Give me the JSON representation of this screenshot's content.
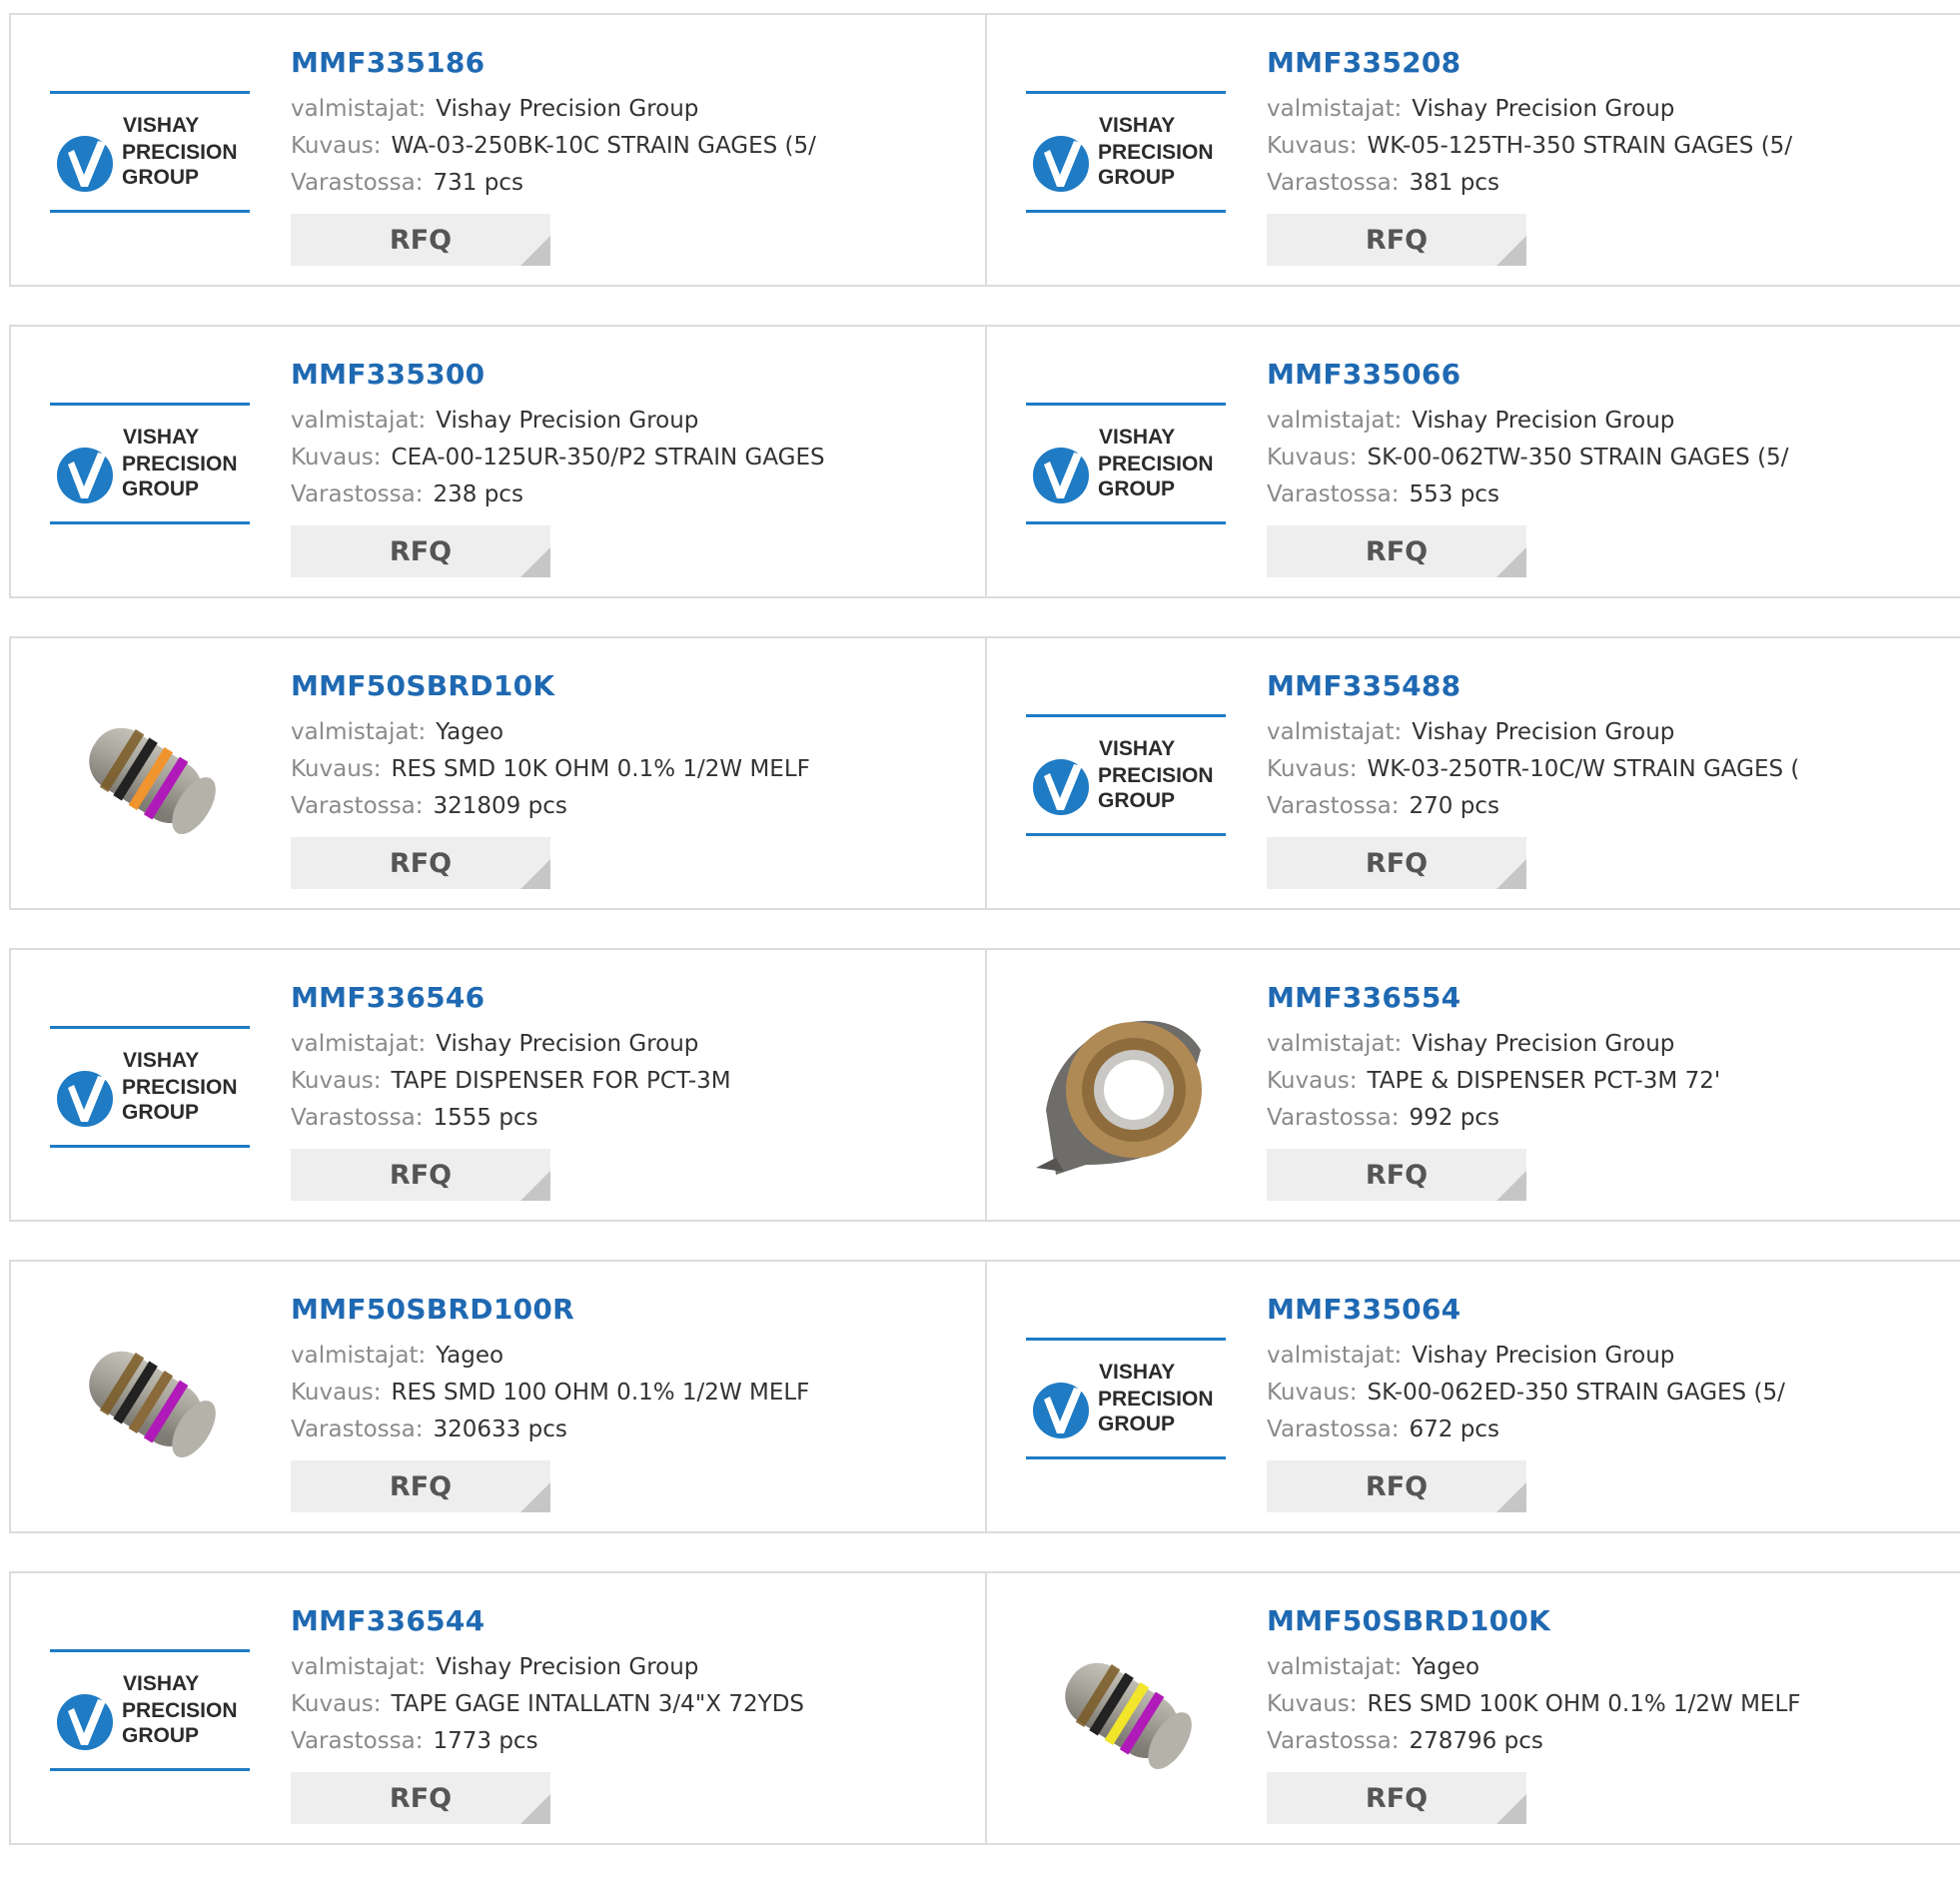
{
  "labels": {
    "manufacturer": "valmistajat:",
    "description": "Kuvaus:",
    "stock": "Varastossa:",
    "rfq": "RFQ"
  },
  "logo_text": [
    "VISHAY",
    "PRECISION",
    "GROUP"
  ],
  "colors": {
    "link": "#1f69b2",
    "vishay_blue": "#1e7bc4",
    "button_bg": "#eeeeee"
  },
  "products": [
    {
      "pn": "MMF335186",
      "manufacturer": "Vishay Precision Group",
      "description": "WA-03-250BK-10C STRAIN GAGES (5/",
      "stock": "731 pcs",
      "image": "vishay-logo"
    },
    {
      "pn": "MMF335208",
      "manufacturer": "Vishay Precision Group",
      "description": "WK-05-125TH-350 STRAIN GAGES (5/",
      "stock": "381 pcs",
      "image": "vishay-logo"
    },
    {
      "pn": "MMF335300",
      "manufacturer": "Vishay Precision Group",
      "description": "CEA-00-125UR-350/P2 STRAIN GAGES",
      "stock": "238 pcs",
      "image": "vishay-logo"
    },
    {
      "pn": "MMF335066",
      "manufacturer": "Vishay Precision Group",
      "description": "SK-00-062TW-350 STRAIN GAGES (5/",
      "stock": "553 pcs",
      "image": "vishay-logo"
    },
    {
      "pn": "MMF50SBRD10K",
      "manufacturer": "Yageo",
      "description": "RES SMD 10K OHM 0.1% 1/2W MELF",
      "stock": "321809 pcs",
      "image": "melf-resistor",
      "bands": [
        "#222222",
        "#f0942e",
        "#b01ab8"
      ]
    },
    {
      "pn": "MMF335488",
      "manufacturer": "Vishay Precision Group",
      "description": "WK-03-250TR-10C/W STRAIN GAGES (",
      "stock": "270 pcs",
      "image": "vishay-logo"
    },
    {
      "pn": "MMF336546",
      "manufacturer": "Vishay Precision Group",
      "description": "TAPE DISPENSER FOR PCT-3M",
      "stock": "1555 pcs",
      "image": "vishay-logo"
    },
    {
      "pn": "MMF336554",
      "manufacturer": "Vishay Precision Group",
      "description": "TAPE & DISPENSER PCT-3M 72'",
      "stock": "992 pcs",
      "image": "tape-dispenser"
    },
    {
      "pn": "MMF50SBRD100R",
      "manufacturer": "Yageo",
      "description": "RES SMD 100 OHM 0.1% 1/2W MELF",
      "stock": "320633 pcs",
      "image": "melf-resistor",
      "bands": [
        "#222222",
        "#8a6a3a",
        "#b01ab8"
      ]
    },
    {
      "pn": "MMF335064",
      "manufacturer": "Vishay Precision Group",
      "description": "SK-00-062ED-350 STRAIN GAGES (5/",
      "stock": "672 pcs",
      "image": "vishay-logo"
    },
    {
      "pn": "MMF336544",
      "manufacturer": "Vishay Precision Group",
      "description": "TAPE GAGE INTALLATN 3/4\"X 72YDS",
      "stock": "1773 pcs",
      "image": "vishay-logo"
    },
    {
      "pn": "MMF50SBRD100K",
      "manufacturer": "Yageo",
      "description": "RES SMD 100K OHM 0.1% 1/2W MELF",
      "stock": "278796 pcs",
      "image": "melf-resistor",
      "bands": [
        "#222222",
        "#f2e52a",
        "#b01ab8"
      ]
    }
  ]
}
